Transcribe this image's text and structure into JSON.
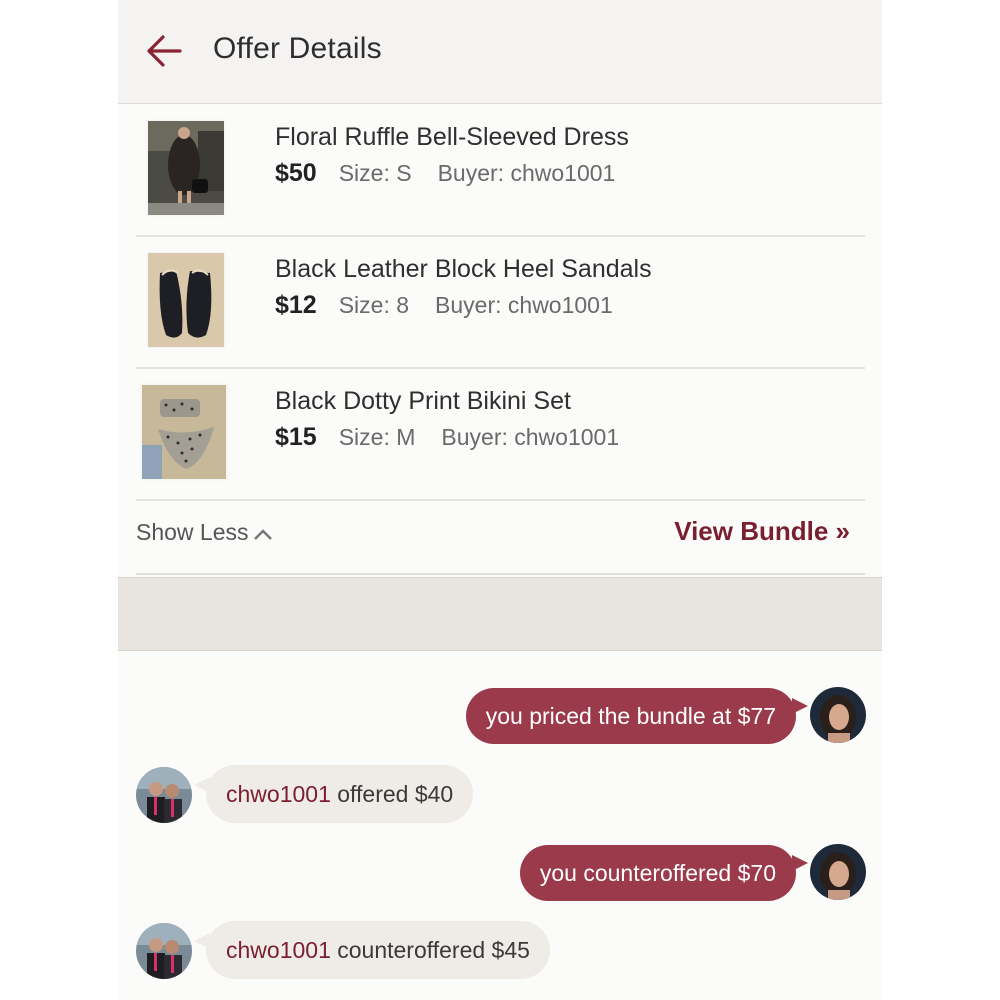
{
  "header": {
    "title": "Offer Details"
  },
  "items": [
    {
      "name": "Floral Ruffle Bell-Sleeved Dress",
      "price": "$50",
      "size": "Size: S",
      "buyer": "Buyer: chwo1001",
      "thumb_icon": "dress-photo"
    },
    {
      "name": "Black Leather Block Heel Sandals",
      "price": "$12",
      "size": "Size: 8",
      "buyer": "Buyer: chwo1001",
      "thumb_icon": "sandals-photo"
    },
    {
      "name": "Black Dotty Print Bikini Set",
      "price": "$15",
      "size": "Size: M",
      "buyer": "Buyer: chwo1001",
      "thumb_icon": "bikini-photo"
    }
  ],
  "actions": {
    "show_less": "Show Less",
    "view_bundle": "View Bundle »"
  },
  "chat": [
    {
      "from": "me",
      "text": "you priced the bundle at $77"
    },
    {
      "from": "them",
      "user": "chwo1001",
      "text": " offered $40"
    },
    {
      "from": "me",
      "text": "you counteroffered $70"
    },
    {
      "from": "them",
      "user": "chwo1001",
      "text": " counteroffered $45"
    }
  ],
  "colors": {
    "accent": "#7a1f2f",
    "my_bubble": "#9a3a4a",
    "their_bubble": "#efece8",
    "header_bg": "#f4f3f2"
  }
}
